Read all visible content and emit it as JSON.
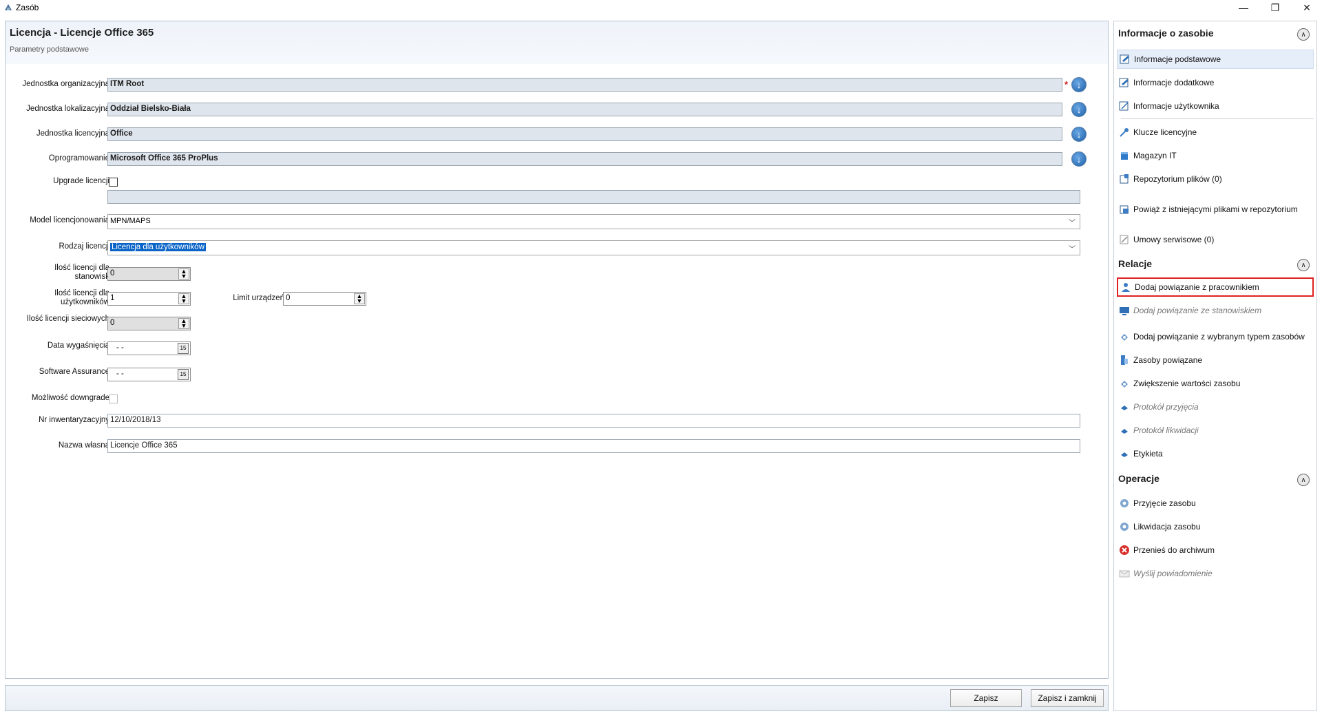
{
  "window": {
    "title": "Zasób",
    "min": "—",
    "max": "❐",
    "close": "✕"
  },
  "form": {
    "title": "Licencja - Licencje Office 365",
    "subtitle": "Parametry podstawowe",
    "fields": {
      "org_unit": {
        "label": "Jednostka organizacyjna",
        "value": "ITM Root",
        "required": "*"
      },
      "loc_unit": {
        "label": "Jednostka lokalizacyjna",
        "value": "Oddział Bielsko-Biała"
      },
      "lic_unit": {
        "label": "Jednostka licencyjna",
        "value": "Office"
      },
      "software": {
        "label": "Oprogramowanie",
        "value": "Microsoft Office 365 ProPlus"
      },
      "upgrade": {
        "label": "Upgrade licencji",
        "value": ""
      },
      "model": {
        "label": "Model licencjonowania",
        "value": "MPN/MAPS"
      },
      "license_type": {
        "label": "Rodzaj licencji",
        "value": "Licencja dla użytkowników"
      },
      "qty_stations": {
        "label_1": "Ilość licencji dla",
        "label_2": "stanowisk",
        "value": "0"
      },
      "qty_users": {
        "label_1": "Ilość licencji dla",
        "label_2": "użytkowników",
        "value": "1"
      },
      "device_limit": {
        "label": "Limit urządzeń",
        "value": "0"
      },
      "qty_network": {
        "label": "Ilość licencji sieciowych",
        "value": "0"
      },
      "expiry": {
        "label": "Data wygaśnięcia",
        "value": "-  -"
      },
      "software_assurance": {
        "label": "Software Assurance",
        "value": "-  -"
      },
      "downgrade": {
        "label": "Możliwość downgrade"
      },
      "inventory_no": {
        "label": "Nr inwentaryzacyjny",
        "value": "12/10/2018/13"
      },
      "own_name": {
        "label": "Nazwa własna",
        "value": "Licencje Office 365"
      }
    }
  },
  "footer": {
    "save": "Zapisz",
    "save_close": "Zapisz i zamknij"
  },
  "right_panel": {
    "info": {
      "title": "Informacje o zasobie",
      "items": [
        "Informacje podstawowe",
        "Informacje dodatkowe",
        "Informacje użytkownika",
        "Klucze licencyjne",
        "Magazyn IT",
        "Repozytorium plików (0)",
        "Powiąż z istniejącymi plikami w repozytorium",
        "Umowy serwisowe (0)"
      ]
    },
    "relations": {
      "title": "Relacje",
      "items": [
        "Dodaj powiązanie z pracownikiem",
        "Dodaj powiązanie ze stanowiskiem",
        "Dodaj powiązanie z wybranym typem zasobów",
        "Zasoby powiązane",
        "Zwiększenie wartości zasobu",
        "Protokół przyjęcia",
        "Protokół likwidacji",
        "Etykieta"
      ]
    },
    "operations": {
      "title": "Operacje",
      "items": [
        "Przyjęcie zasobu",
        "Likwidacja zasobu",
        "Przenieś do archiwum",
        "Wyślij powiadomienie"
      ]
    }
  }
}
